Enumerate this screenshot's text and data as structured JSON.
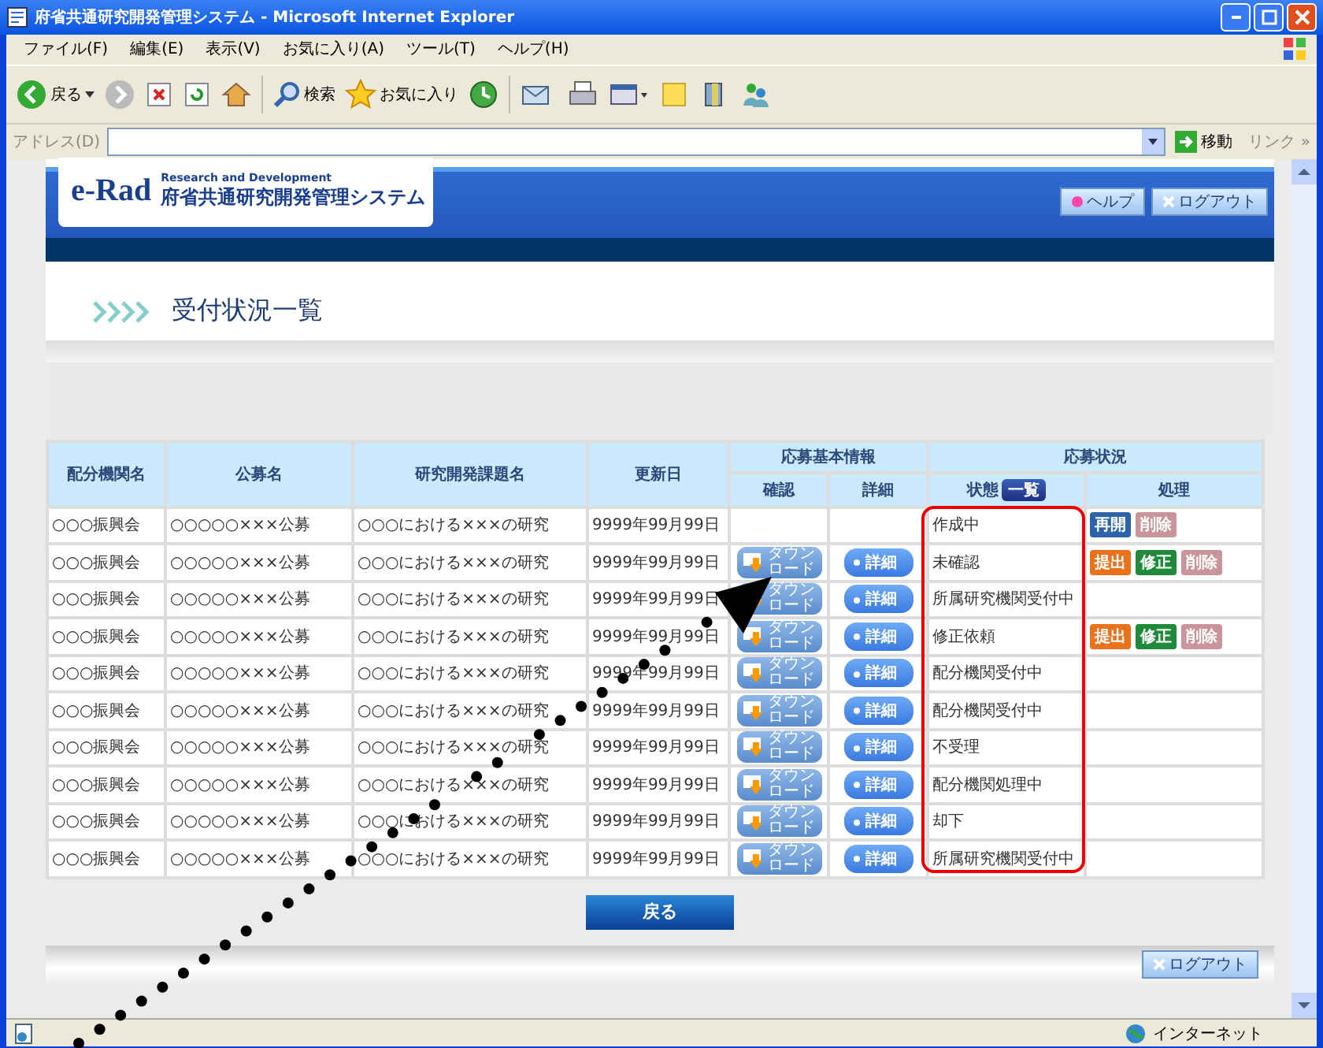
{
  "window": {
    "title": "府省共通研究開発管理システム - Microsoft Internet Explorer"
  },
  "menu": [
    "ファイル(F)",
    "編集(E)",
    "表示(V)",
    "お気に入り(A)",
    "ツール(T)",
    "ヘルプ(H)"
  ],
  "toolbar": {
    "back": "戻る",
    "search": "検索",
    "favorites": "お気に入り"
  },
  "address_bar": {
    "label": "アドレス(D)",
    "go": "移動",
    "links": "リンク »"
  },
  "header": {
    "logo": "e-Rad",
    "tagline": "Research and Development",
    "system_name": "府省共通研究開発管理システム",
    "help": "ヘルプ",
    "logout": "ログアウト"
  },
  "page_title": "受付状況一覧",
  "table": {
    "columns": [
      "配分機関名",
      "公募名",
      "研究開発課題名",
      "更新日"
    ],
    "groups": [
      {
        "label": "応募基本情報",
        "columns": [
          "確認",
          "詳細"
        ]
      },
      {
        "label": "応募状況",
        "columns": [
          "状態",
          "処理"
        ]
      }
    ],
    "status_list_button": "一覧",
    "rows": [
      {
        "agency": "○○○振興会",
        "call": "○○○○○×××公募",
        "project": "○○○における×××の研究",
        "updated": "9999年99月99日",
        "status": "作成中",
        "actions": [
          {
            "kind": "resume",
            "label": "再開"
          },
          {
            "kind": "delete",
            "label": "削除"
          }
        ]
      },
      {
        "agency": "○○○振興会",
        "call": "○○○○○×××公募",
        "project": "○○○における×××の研究",
        "updated": "9999年99月99日",
        "download": "ダウンロード",
        "details": "詳細",
        "status": "未確認",
        "actions": [
          {
            "kind": "submit",
            "label": "提出"
          },
          {
            "kind": "edit",
            "label": "修正"
          },
          {
            "kind": "delete",
            "label": "削除"
          }
        ]
      },
      {
        "agency": "○○○振興会",
        "call": "○○○○○×××公募",
        "project": "○○○における×××の研究",
        "updated": "9999年99月99日",
        "download": "ダウンロード",
        "details": "詳細",
        "status": "所属研究機関受付中",
        "actions": []
      },
      {
        "agency": "○○○振興会",
        "call": "○○○○○×××公募",
        "project": "○○○における×××の研究",
        "updated": "9999年99月99日",
        "download": "ダウンロード",
        "details": "詳細",
        "status": "修正依頼",
        "actions": [
          {
            "kind": "submit",
            "label": "提出"
          },
          {
            "kind": "edit",
            "label": "修正"
          },
          {
            "kind": "delete",
            "label": "削除"
          }
        ]
      },
      {
        "agency": "○○○振興会",
        "call": "○○○○○×××公募",
        "project": "○○○における×××の研究",
        "updated": "9999年99月99日",
        "download": "ダウンロード",
        "details": "詳細",
        "status": "配分機関受付中",
        "actions": []
      },
      {
        "agency": "○○○振興会",
        "call": "○○○○○×××公募",
        "project": "○○○における×××の研究",
        "updated": "9999年99月99日",
        "download": "ダウンロード",
        "details": "詳細",
        "status": "配分機関受付中",
        "actions": []
      },
      {
        "agency": "○○○振興会",
        "call": "○○○○○×××公募",
        "project": "○○○における×××の研究",
        "updated": "9999年99月99日",
        "download": "ダウンロード",
        "details": "詳細",
        "status": "不受理",
        "actions": []
      },
      {
        "agency": "○○○振興会",
        "call": "○○○○○×××公募",
        "project": "○○○における×××の研究",
        "updated": "9999年99月99日",
        "download": "ダウンロード",
        "details": "詳細",
        "status": "配分機関処理中",
        "actions": []
      },
      {
        "agency": "○○○振興会",
        "call": "○○○○○×××公募",
        "project": "○○○における×××の研究",
        "updated": "9999年99月99日",
        "download": "ダウンロード",
        "details": "詳細",
        "status": "却下",
        "actions": []
      },
      {
        "agency": "○○○振興会",
        "call": "○○○○○×××公募",
        "project": "○○○における×××の研究",
        "updated": "9999年99月99日",
        "download": "ダウンロード",
        "details": "詳細",
        "status": "所属研究機関受付中",
        "actions": []
      }
    ]
  },
  "back_button": "戻る",
  "footer": {
    "logout": "ログアウト"
  },
  "status_bar": {
    "zone": "インターネット"
  }
}
